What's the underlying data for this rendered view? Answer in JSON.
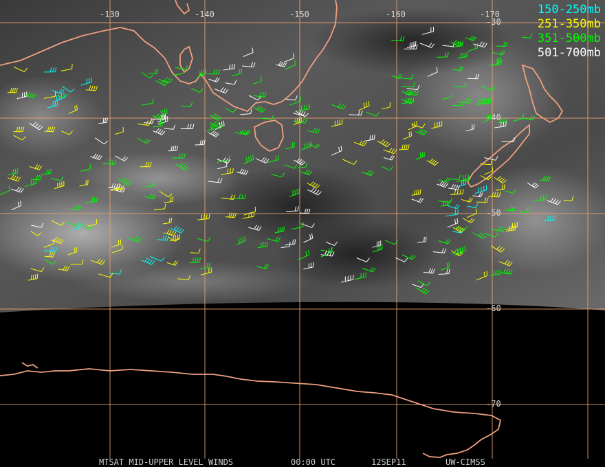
{
  "legend": [
    {
      "label": "150-250mb",
      "color": "#00ffff"
    },
    {
      "label": "251-350mb",
      "color": "#ffff00"
    },
    {
      "label": "351-500mb",
      "color": "#00ff00"
    },
    {
      "label": "501-700mb",
      "color": "#ffffff"
    }
  ],
  "longitude_labels": [
    "-130",
    "-140",
    "-150",
    "-160",
    "-170"
  ],
  "latitude_labels": [
    "-30",
    "-40",
    "-50",
    "-60",
    "-70"
  ],
  "footer": {
    "product": "MTSAT MID-UPPER LEVEL WINDS",
    "time": "00:00 UTC",
    "date": "12SEP11",
    "source": "UW-CIMSS"
  },
  "colors": {
    "coastline": "#f0a080",
    "gridline": "#e8a070",
    "background": "#000000"
  }
}
